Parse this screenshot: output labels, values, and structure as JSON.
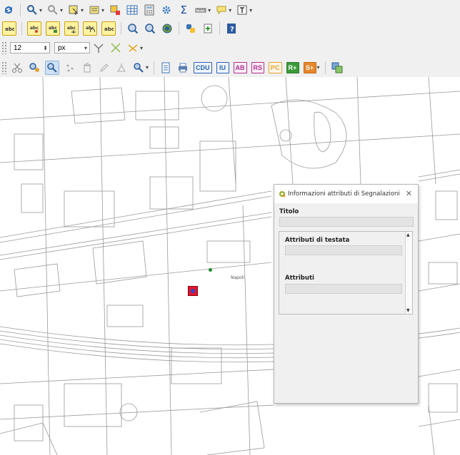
{
  "toolbar": {
    "symbol_size_value": "12",
    "symbol_size_unit": "px",
    "row4_label_buttons": [
      {
        "label": "CDU",
        "color": "#2a62b8"
      },
      {
        "label": "IU",
        "color": "#2a62b8"
      },
      {
        "label": "AB",
        "color": "#b5308e"
      },
      {
        "label": "RS",
        "color": "#b5308e"
      },
      {
        "label": "PC",
        "color": "#e3a431"
      }
    ],
    "row4_filled_buttons": [
      {
        "label": "R+",
        "color": "#3a9a3a"
      },
      {
        "label": "S+",
        "color": "#e8862a"
      }
    ],
    "sum_glyph": "Σ"
  },
  "map": {
    "place_label": "Napoli"
  },
  "dialog": {
    "title": "Informazioni attributi di Segnalazioni",
    "field_titolo_label": "Titolo",
    "section_testata_label": "Attributi di testata",
    "section_attributi_label": "Attributi"
  }
}
